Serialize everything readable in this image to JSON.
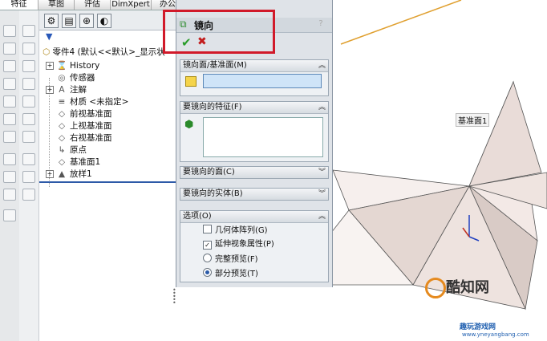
{
  "tabs": [
    "特征",
    "草图",
    "评估",
    "DimXpert",
    "办公室产品"
  ],
  "feature_tree": {
    "root": "零件4 (默认<<默认>_显示状",
    "items": [
      {
        "label": "History",
        "icon": "history-icon",
        "expand": true
      },
      {
        "label": "传感器",
        "icon": "sensor-icon",
        "expand": false
      },
      {
        "label": "注解",
        "icon": "annotation-icon",
        "expand": true
      },
      {
        "label": "材质 <未指定>",
        "icon": "material-icon",
        "expand": false
      },
      {
        "label": "前视基准面",
        "icon": "plane-icon",
        "expand": false
      },
      {
        "label": "上视基准面",
        "icon": "plane-icon",
        "expand": false
      },
      {
        "label": "右视基准面",
        "icon": "plane-icon",
        "expand": false
      },
      {
        "label": "原点",
        "icon": "origin-icon",
        "expand": false
      },
      {
        "label": "基准面1",
        "icon": "plane-icon",
        "expand": false
      },
      {
        "label": "放样1",
        "icon": "loft-icon",
        "expand": true
      }
    ]
  },
  "property_manager": {
    "title": "镜向",
    "help": "?",
    "ok": "✔",
    "cancel": "✖",
    "groups": {
      "mirror_face": "镜向面/基准面(M)",
      "features": "要镜向的特征(F)",
      "faces": "要镜向的面(C)",
      "bodies": "要镜向的实体(B)",
      "options": "选项(O)"
    },
    "options": {
      "geometry_pattern": {
        "label": "几何体阵列(G)",
        "checked": false
      },
      "propagate_visual": {
        "label": "延伸视象属性(P)",
        "checked": true
      },
      "full_preview": {
        "label": "完整预览(F)",
        "selected": false
      },
      "partial_preview": {
        "label": "部分预览(T)",
        "selected": true
      }
    }
  },
  "graphics": {
    "plane_label": "基准面1",
    "watermark": "酷知网",
    "watermark_site": "趣玩游戏网",
    "watermark_url": "www.yneyangbang.com"
  },
  "colors": {
    "highlight": "#d11a2a",
    "plane_edge": "#e0a030",
    "accent": "#2a5aa8"
  }
}
